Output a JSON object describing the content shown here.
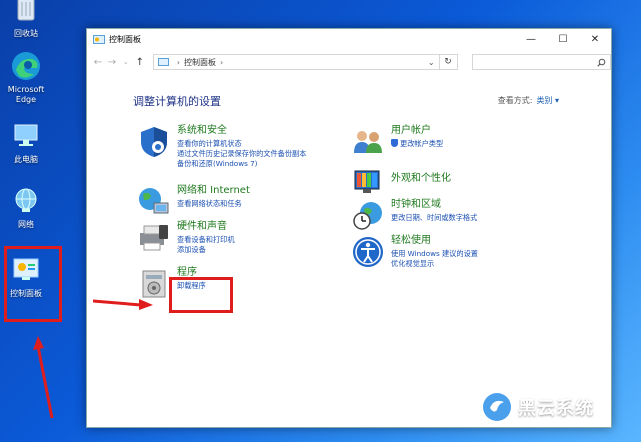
{
  "desktop": {
    "icons": [
      {
        "label": "回收站"
      },
      {
        "label": "Microsoft Edge"
      },
      {
        "label": "此电脑"
      },
      {
        "label": "网络"
      },
      {
        "label": "控制面板"
      }
    ]
  },
  "window": {
    "title": "控制面板",
    "controls": {
      "minimize": "—",
      "maximize": "☐",
      "close": "✕"
    },
    "address": {
      "path": "控制面板",
      "sep1": "›",
      "sep2": "›"
    },
    "search": {
      "placeholder": ""
    },
    "heading": "调整计算机的设置",
    "view_by": {
      "label": "查看方式:",
      "value": "类别 ▾"
    },
    "categories": [
      {
        "title": "系统和安全",
        "links": [
          "查看你的计算机状态",
          "通过文件历史记录保存你的文件备份副本",
          "备份和还原(Windows 7)"
        ]
      },
      {
        "title": "网络和 Internet",
        "links": [
          "查看网络状态和任务"
        ]
      },
      {
        "title": "硬件和声音",
        "links": [
          "查看设备和打印机",
          "添加设备"
        ]
      },
      {
        "title": "程序",
        "links": [
          "卸载程序"
        ]
      },
      {
        "title": "用户帐户",
        "links": [
          "更改帐户类型"
        ]
      },
      {
        "title": "外观和个性化",
        "links": []
      },
      {
        "title": "时钟和区域",
        "links": [
          "更改日期、时间或数字格式"
        ]
      },
      {
        "title": "轻松使用",
        "links": [
          "使用 Windows 建议的设置",
          "优化视觉显示"
        ]
      }
    ]
  },
  "watermark": {
    "text": "黑云系统"
  },
  "colors": {
    "annotation": "#e01d1d",
    "link": "#1a4fb0",
    "category_title": "#1f7a1f",
    "heading": "#1e3287"
  }
}
